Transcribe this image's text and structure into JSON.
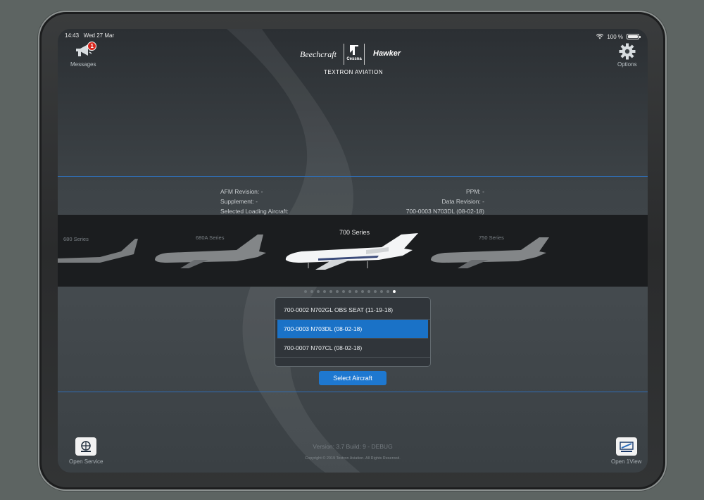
{
  "status_bar": {
    "time": "14:43",
    "date": "Wed 27 Mar",
    "battery": "100 %"
  },
  "header": {
    "messages_label": "Messages",
    "messages_badge": "1",
    "options_label": "Options",
    "logos": {
      "beechcraft": "Beechcraft",
      "cessna": "Cessna",
      "hawker": "Hawker",
      "textron": "TEXTRON AVIATION"
    }
  },
  "info": {
    "afm_revision": "AFM Revision: -",
    "supplement": "Supplement: -",
    "selected_loading_aircraft": "Selected Loading Aircraft:",
    "ppm": "PPM: -",
    "data_revision": "Data Revision: -",
    "selected_aircraft_value": "700-0003 N703DL (08-02-18)"
  },
  "carousel": {
    "series": [
      {
        "label": "680 Series"
      },
      {
        "label": "680A Series"
      },
      {
        "label": "700 Series"
      },
      {
        "label": "750 Series"
      }
    ],
    "active_index": 2,
    "page_count": 15,
    "current_page": 14
  },
  "aircraft_list": {
    "items": [
      {
        "label": "700-0002 N702GL OBS SEAT (11-19-18)",
        "selected": false
      },
      {
        "label": "700-0003 N703DL (08-02-18)",
        "selected": true
      },
      {
        "label": "700-0007 N707CL (08-02-18)",
        "selected": false
      }
    ]
  },
  "select_button": "Select Aircraft",
  "footer": {
    "open_service": "Open Service",
    "open_1view": "Open 1View",
    "version": "Version: 3.7 Build: 9 - DEBUG",
    "copyright": "Copyright © 2019 Textron Aviation. All Rights Reserved."
  },
  "colors": {
    "accent": "#1a72c7",
    "badge": "#d9261c",
    "divider": "#2f6fb8"
  }
}
